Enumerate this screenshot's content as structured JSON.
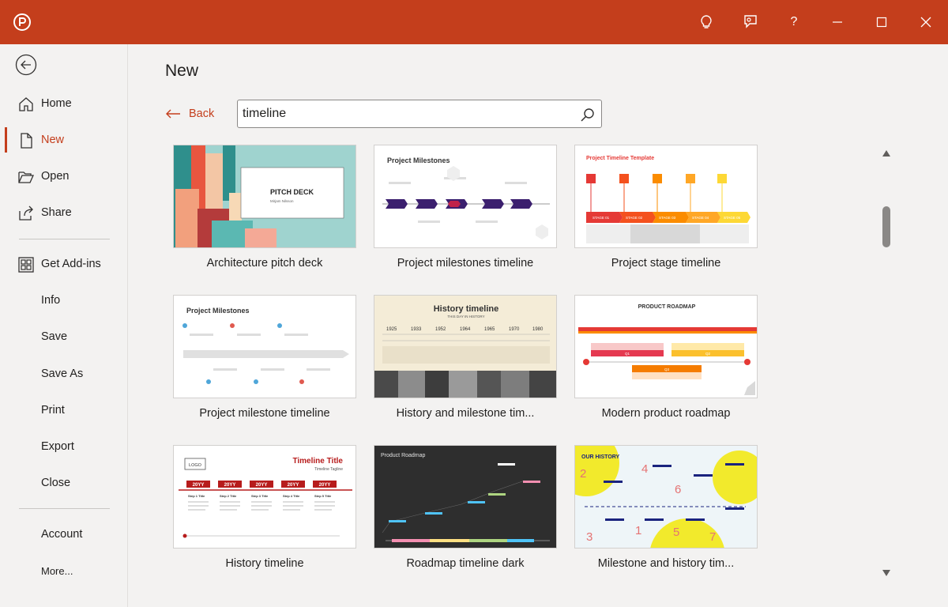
{
  "app": {
    "accent": "#c43e1c",
    "icons": [
      "powerpoint-logo-icon",
      "lightbulb-icon",
      "feedback-icon",
      "help-icon",
      "minimize-icon",
      "maximize-icon",
      "close-icon"
    ],
    "help_label": "?"
  },
  "sidebar": {
    "items": [
      {
        "label": "Home",
        "icon": "home-icon"
      },
      {
        "label": "New",
        "icon": "new-document-icon",
        "active": true
      },
      {
        "label": "Open",
        "icon": "folder-open-icon"
      },
      {
        "label": "Share",
        "icon": "share-icon"
      },
      {
        "label": "Get Add-ins",
        "icon": "add-ins-grid-icon"
      },
      {
        "label": "Info"
      },
      {
        "label": "Save"
      },
      {
        "label": "Save As"
      },
      {
        "label": "Print"
      },
      {
        "label": "Export"
      },
      {
        "label": "Close"
      },
      {
        "label": "Account"
      },
      {
        "label": "More..."
      }
    ]
  },
  "main": {
    "title": "New",
    "back_label": "Back",
    "search": {
      "value": "timeline",
      "placeholder": ""
    },
    "templates": [
      {
        "name": "Architecture pitch deck",
        "thumb_title": "PITCH DECK",
        "thumb_subtitle": "Mirjam Nilsson"
      },
      {
        "name": "Project milestones timeline",
        "thumb_title": "Project Milestones"
      },
      {
        "name": "Project stage timeline",
        "thumb_title": "Project Timeline Template",
        "stages": [
          "STAGE 01",
          "STAGE 02",
          "STAGE 03",
          "STAGE 04",
          "STAGE 05"
        ]
      },
      {
        "name": "Project milestone timeline",
        "thumb_title": "Project Milestones"
      },
      {
        "name": "History and milestone tim...",
        "thumb_title": "History timeline",
        "thumb_subtitle": "THIS DAY IN HISTORY",
        "years": [
          "1925",
          "1933",
          "1952",
          "1964",
          "1965",
          "1970",
          "1980"
        ]
      },
      {
        "name": "Modern product roadmap",
        "thumb_title": "PRODUCT ROADMAP",
        "quarters": [
          "Q1",
          "Q2",
          "Q3"
        ]
      },
      {
        "name": "History timeline",
        "thumb_title": "Timeline Title",
        "thumb_subtitle": "Timeline Tagline",
        "logo_label": "LOGO",
        "years": [
          "20YY",
          "20YY",
          "20YY",
          "20YY",
          "20YY",
          "20YY"
        ],
        "steps": [
          "Step 1 Title",
          "Step 2 Title",
          "Step 3 Title",
          "Step 4 Title",
          "Step 5 Title"
        ]
      },
      {
        "name": "Roadmap timeline dark",
        "thumb_title": "Product Roadmap"
      },
      {
        "name": "Milestone and history tim...",
        "thumb_title": "OUR HISTORY",
        "numbers": [
          "1",
          "2",
          "3",
          "4",
          "5",
          "6",
          "7"
        ]
      }
    ]
  },
  "scrollbar": {
    "position": 0.14
  }
}
